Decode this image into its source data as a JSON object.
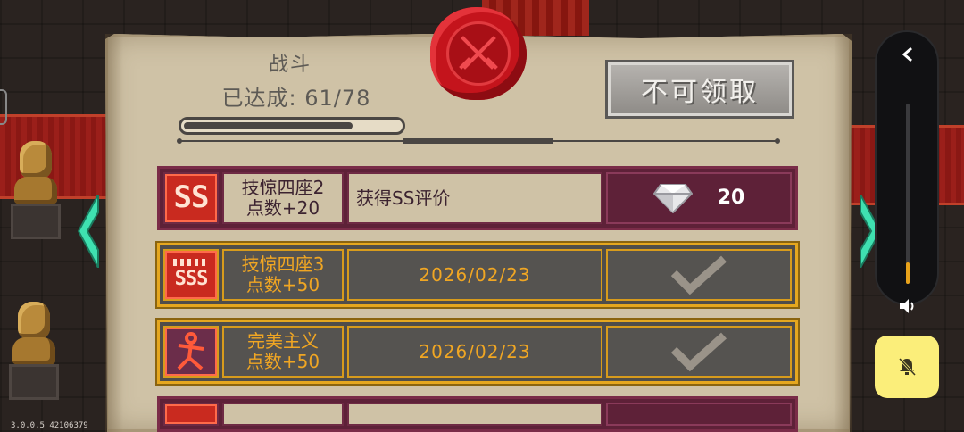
{
  "category": {
    "title": "战斗",
    "progress_text": "已达成: 61/78",
    "progress_fraction": 0.78
  },
  "claim_button": {
    "label": "不可领取"
  },
  "achievements": [
    {
      "badge": "SS",
      "name_line1": "技惊四座2",
      "name_line2": "点数+20",
      "description": "获得SS评价",
      "reward": {
        "icon": "diamond-icon",
        "amount": "20"
      },
      "status": "locked"
    },
    {
      "badge": "SSS",
      "name_line1": "技惊四座3",
      "name_line2": "点数+50",
      "date": "2026/02/23",
      "status": "completed",
      "icon": "checkmark-icon"
    },
    {
      "badge": "figure",
      "name_line1": "完美主义",
      "name_line2": "点数+50",
      "date": "2026/02/23",
      "status": "completed",
      "icon": "checkmark-icon"
    }
  ],
  "version": "3.0.0.5 42106379",
  "colors": {
    "locked_row": "#5e2138",
    "completed_border": "#e5a71f",
    "completed_text": "#f0a623",
    "parchment": "#cfc2a6",
    "seal_red": "#c4141c",
    "volume_accent": "#e8a21a",
    "mute_button": "#fbee7a"
  },
  "system": {
    "volume_level": 0.12
  }
}
